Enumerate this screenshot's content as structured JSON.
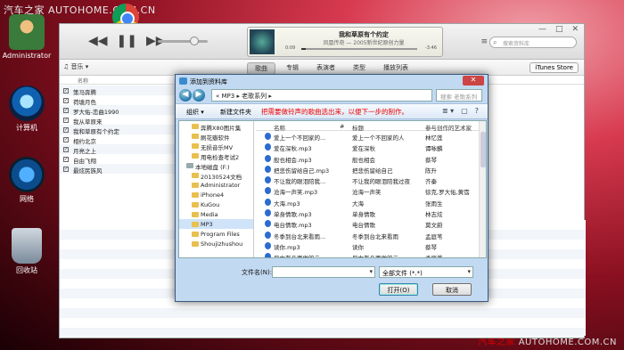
{
  "watermark": {
    "top": "汽车之家 AUTOHOME.COM.CN",
    "bottom_brand": "汽车之家",
    "bottom_site": "AUTOHOME.COM.CN"
  },
  "desktop": {
    "icons": [
      {
        "label": "Administrator"
      },
      {
        "label": "计算机"
      },
      {
        "label": "网络"
      },
      {
        "label": "回收站"
      }
    ]
  },
  "itunes": {
    "transport": {
      "prev": "◀◀",
      "pause": "❚❚",
      "next": "▶▶"
    },
    "now_playing": {
      "title": "我和草原有个约定",
      "artist": "凤凰传奇 — 2005新世纪原创力量",
      "elapsed": "0:09",
      "remaining": "-3:46",
      "progress": 0.04
    },
    "window_controls": [
      "—",
      "□",
      "✕"
    ],
    "search_placeholder": "搜索资料库",
    "library_selector": "♫ 音乐 ▾",
    "tabs": [
      "歌曲",
      "专辑",
      "表演者",
      "类型",
      "播放列表"
    ],
    "active_tab": "歌曲",
    "store_button": "iTunes Store",
    "song_header": "名称",
    "songs": [
      "策马奔腾",
      "荷塘月色",
      "罗大佑-恋曲1990",
      "我从草原来",
      "我和草原有个约定",
      "相约北京",
      "月亮之上",
      "自由飞翔",
      "最炫民族风"
    ]
  },
  "dialog": {
    "title": "添加到资料库",
    "close": "✕",
    "back": "◀",
    "forward": "▶",
    "address": "« MP3 ▸ 老歌系列 ▸",
    "search_placeholder": "搜索 老歌系列",
    "organize": "组织 ▾",
    "new_folder": "新建文件夹",
    "annotation": "把需要做铃声的歌曲选出来，以便下一步的制作。",
    "view_icons": [
      "≣ ▾",
      "▢",
      "?"
    ],
    "tree": [
      {
        "label": "奔腾X80图片集",
        "type": "folder"
      },
      {
        "label": "刷花瓣软件",
        "type": "folder"
      },
      {
        "label": "无损音乐MV",
        "type": "folder"
      },
      {
        "label": "用电检查考试2",
        "type": "folder"
      },
      {
        "label": "本地磁盘 (F:)",
        "type": "drive"
      },
      {
        "label": "20130524文档",
        "type": "folder"
      },
      {
        "label": "Administrator",
        "type": "folder"
      },
      {
        "label": "iPhone4",
        "type": "folder"
      },
      {
        "label": "KuGou",
        "type": "folder"
      },
      {
        "label": "Media",
        "type": "folder"
      },
      {
        "label": "MP3",
        "type": "folder",
        "selected": true
      },
      {
        "label": "Program Files",
        "type": "folder"
      },
      {
        "label": "Shoujizhushou",
        "type": "folder"
      }
    ],
    "columns": {
      "name": "名称",
      "number": "#",
      "title": "标题",
      "artist": "参与创作的艺术家"
    },
    "files": [
      {
        "name": "爱上一个不回家的...",
        "title": "爱上一个不回家的人",
        "artist": "林忆莲"
      },
      {
        "name": "爱在深秋.mp3",
        "title": "爱在深秋",
        "artist": "谭咏麟"
      },
      {
        "name": "般也相会.mp3",
        "title": "般也相会",
        "artist": "蔡琴"
      },
      {
        "name": "把悲伤留给自己.mp3",
        "title": "把悲伤留给自己",
        "artist": "陈升"
      },
      {
        "name": "不让我的眼泪陪我...",
        "title": "不让我的眼泪陪我过夜",
        "artist": "齐秦"
      },
      {
        "name": "沧海一声笑.mp3",
        "title": "沧海一声笑",
        "artist": "徐克,罗大佑,黄霑"
      },
      {
        "name": "大海.mp3",
        "title": "大海",
        "artist": "张雨生"
      },
      {
        "name": "单身情歌.mp3",
        "title": "单身情歌",
        "artist": "林志炫"
      },
      {
        "name": "电台情歌.mp3",
        "title": "电台情歌",
        "artist": "莫文蔚"
      },
      {
        "name": "冬季到台北来看雨...",
        "title": "冬季到台北来看雨",
        "artist": "孟庭苇"
      },
      {
        "name": "读你.mp3",
        "title": "读你",
        "artist": "蔡琴"
      },
      {
        "name": "风中有朵雨做的云...",
        "title": "风中有朵雨做的云",
        "artist": "孟庭苇"
      }
    ],
    "filename_label": "文件名(N):",
    "filename_value": "",
    "filter": "全部文件 (*.*)",
    "open_button": "打开(O)",
    "cancel_button": "取消"
  }
}
